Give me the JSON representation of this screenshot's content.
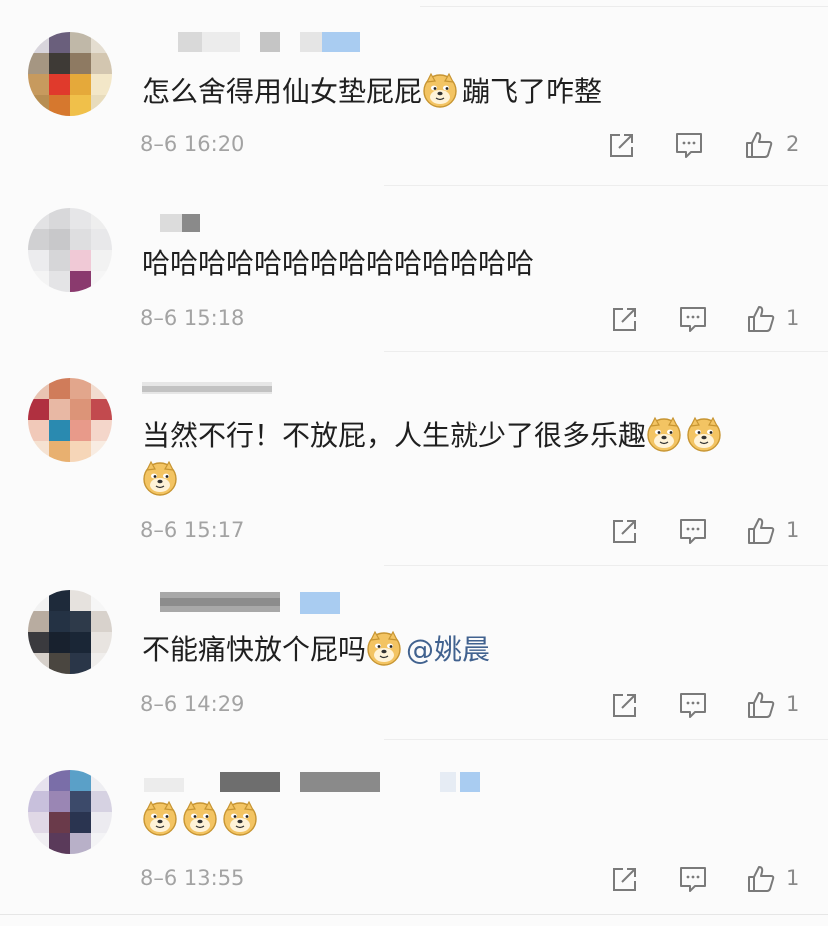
{
  "comments": [
    {
      "text": "怎么舍得用仙女垫屁屁",
      "after_emoji": "蹦飞了咋整",
      "time": "8–6 16:20",
      "likes": "2"
    },
    {
      "text": "哈哈哈哈哈哈哈哈哈哈哈哈哈哈",
      "time": "8–6 15:18",
      "likes": "1"
    },
    {
      "text": "当然不行！不放屁，人生就少了很多乐趣",
      "time": "8–6 15:17",
      "likes": "1"
    },
    {
      "text": "不能痛快放个屁吗",
      "mention": "@姚晨",
      "time": "8–6 14:29",
      "likes": "1"
    },
    {
      "time": "8–6 13:55",
      "likes": "1"
    }
  ],
  "icons": {
    "share": "share-icon",
    "reply": "comment-icon",
    "like": "thumbs-up-icon",
    "emoji": "doge-emoji"
  },
  "colors": {
    "text": "#1f1f1f",
    "timestamp": "#a3a3a3",
    "mention": "#41628f",
    "icon": "#7a7a7a",
    "background": "#fbfbfb",
    "emoji": "#f3c463"
  }
}
